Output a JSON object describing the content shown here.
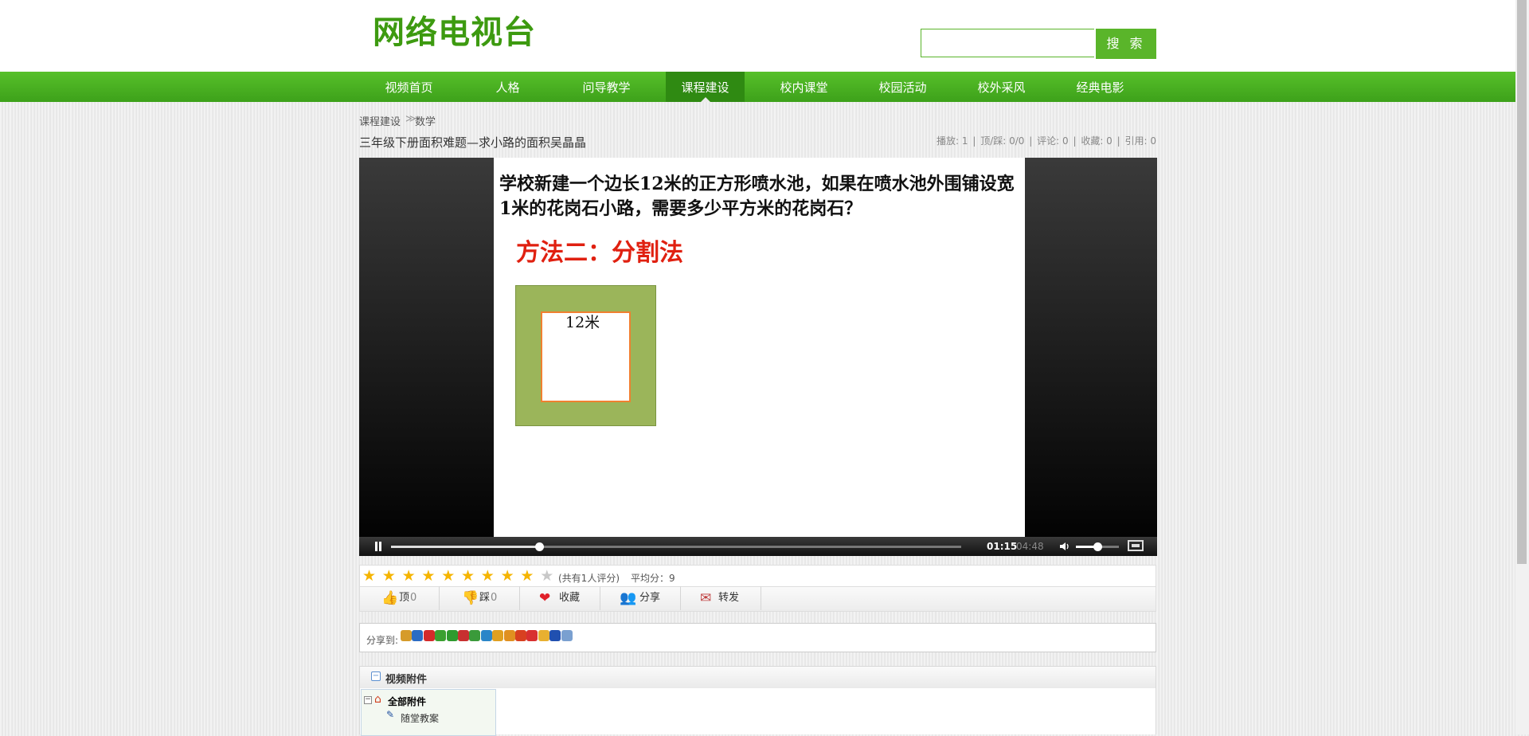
{
  "site": {
    "logo": "网络电视台",
    "search_button": "搜 索",
    "search_value": ""
  },
  "nav": [
    {
      "label": "视频首页",
      "active": false
    },
    {
      "label": "人格",
      "active": false
    },
    {
      "label": "问导教学",
      "active": false
    },
    {
      "label": "课程建设",
      "active": true
    },
    {
      "label": "校内课堂",
      "active": false
    },
    {
      "label": "校园活动",
      "active": false
    },
    {
      "label": "校外采风",
      "active": false
    },
    {
      "label": "经典电影",
      "active": false
    }
  ],
  "breadcrumb": {
    "parent": "课程建设",
    "sep": "≫",
    "current": "数学"
  },
  "video": {
    "title": "三年级下册面积难题—求小路的面积吴晶晶",
    "stats": [
      "播放: 1",
      "|",
      "顶/踩: 0/0",
      "|",
      "评论: 0",
      "|",
      "收藏: 0",
      "|",
      "引用: 0"
    ]
  },
  "slide": {
    "question": "学校新建一个边长12米的正方形喷水池，如果在喷水池外围铺设宽1米的花岗石小路，需要多少平方米的花岗石？",
    "method": "方法二：分割法",
    "square_label": "12米"
  },
  "player": {
    "time_current": "01:15",
    "time_total": "04:48",
    "progress": 0.26,
    "volume": 0.5,
    "icons": [
      "pause-icon",
      "volume-icon",
      "fullscreen-icon"
    ]
  },
  "rating": {
    "stars_filled": 9,
    "stars_total": 10,
    "summary": "(共有1人评分)",
    "average": "平均分：9"
  },
  "actions": [
    {
      "label": "顶",
      "count": "0",
      "icon": "thumb-up-icon"
    },
    {
      "label": "踩",
      "count": "0",
      "icon": "thumb-down-icon"
    },
    {
      "label": "收藏",
      "count": "",
      "icon": "heart-icon"
    },
    {
      "label": "分享",
      "count": "",
      "icon": "users-icon"
    },
    {
      "label": "转发",
      "count": "",
      "icon": "envelope-icon"
    }
  ],
  "share": {
    "label": "分享到:",
    "icons": [
      "qzone-icon",
      "baidu-icon",
      "weibo-icon",
      "kaixin-icon",
      "clover-icon",
      "renren-icon",
      "douban-icon",
      "tencent-icon",
      "sohu-icon",
      "163-icon",
      "taobao-icon",
      "taojianghu-icon",
      "box-icon",
      "flag-icon",
      "globe-icon"
    ],
    "colors": [
      "#d69b2a",
      "#2b6cc4",
      "#d42a2a",
      "#3aa030",
      "#2e9a2e",
      "#c83030",
      "#3a9a3a",
      "#2a86c8",
      "#e0a020",
      "#e09020",
      "#d84020",
      "#d83030",
      "#e8b030",
      "#2050b0",
      "#7aa0d0"
    ]
  },
  "attachments": {
    "title": "视频附件",
    "root": "全部附件",
    "items": [
      "随堂教案"
    ]
  },
  "colors": {
    "brand_green": "#3d9a10",
    "nav_green": "#4cb020",
    "nav_active": "#2f8a12",
    "accent_red": "#e02010"
  }
}
